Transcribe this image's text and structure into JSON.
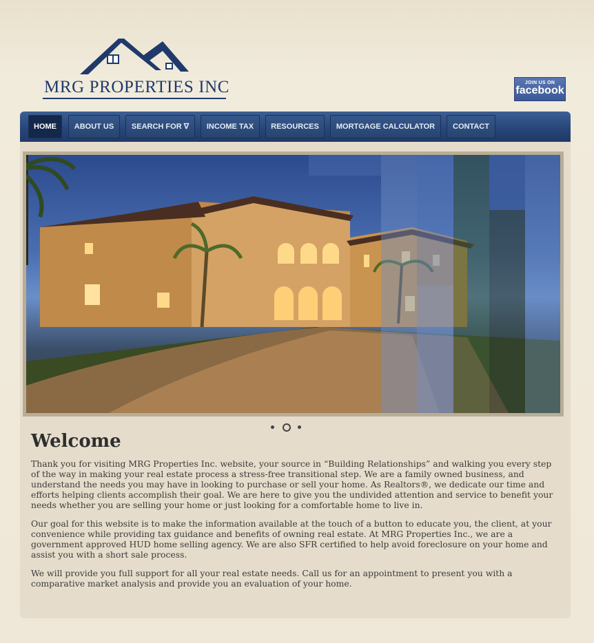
{
  "brand": {
    "name": "MRG PROPERTIES INC",
    "color": "#1f3a6a"
  },
  "facebook": {
    "top": "JOIN US ON",
    "main": "facebook"
  },
  "nav": [
    {
      "label": "HOME",
      "active": true
    },
    {
      "label": "ABOUT US"
    },
    {
      "label": "SEARCH FOR ∇"
    },
    {
      "label": "INCOME TAX"
    },
    {
      "label": "RESOURCES"
    },
    {
      "label": "MORTGAGE CALCULATOR"
    },
    {
      "label": "CONTACT"
    }
  ],
  "slider": {
    "slide_count": 3,
    "active_index": 1,
    "icon": "house-photo"
  },
  "main": {
    "title": "Welcome",
    "paragraphs": [
      "Thank you for visiting MRG Properties Inc. website, your source in “Building Relationships” and walking you every step of the way in making your real estate process a stress-free transitional step. We are a family owned business, and understand the needs you may have in looking to purchase or sell your home. As Realtors®, we dedicate our time and efforts helping clients accomplish their goal. We are here to give you the undivided attention and service to benefit your needs whether you are selling your home or just looking for a comfortable home to live in.",
      "Our goal for this website is to make the information available at the touch of a button to educate you, the client, at your convenience while providing tax guidance and benefits of owning real estate. At MRG Properties Inc., we are a government approved HUD home selling agency. We are also SFR certified to help avoid foreclosure on your home and assist you with a short sale process.",
      "We will provide you full support for all your real estate needs. Call us for an appointment to present you with a comparative market analysis and provide you an evaluation of your home."
    ]
  }
}
